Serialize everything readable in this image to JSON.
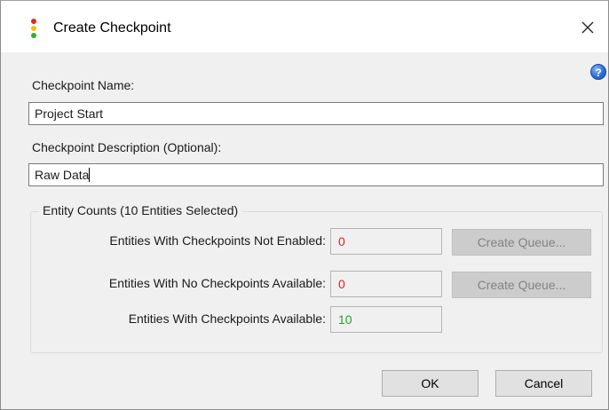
{
  "window": {
    "title": "Create Checkpoint",
    "close_glyph": "✕",
    "icon": "traffic-light-icon",
    "help_glyph": "?"
  },
  "form": {
    "name_label": "Checkpoint Name:",
    "name_value": "Project Start",
    "description_label": "Checkpoint Description (Optional):",
    "description_value": "Raw Data"
  },
  "entity_counts": {
    "title": "Entity Counts (10 Entities Selected)",
    "rows": [
      {
        "label": "Entities With Checkpoints Not Enabled:",
        "value": "0",
        "value_color": "#e02020",
        "button_label": "Create Queue..."
      },
      {
        "label": "Entities With No Checkpoints Available:",
        "value": "0",
        "value_color": "#e02020",
        "button_label": "Create Queue..."
      },
      {
        "label": "Entities With Checkpoints Available:",
        "value": "10",
        "value_color": "#22a322"
      }
    ]
  },
  "buttons": {
    "ok": "OK",
    "cancel": "Cancel"
  },
  "colors": {
    "icon_red": "#e8231f",
    "icon_yellow": "#f2c200",
    "icon_green": "#2fae2f"
  }
}
